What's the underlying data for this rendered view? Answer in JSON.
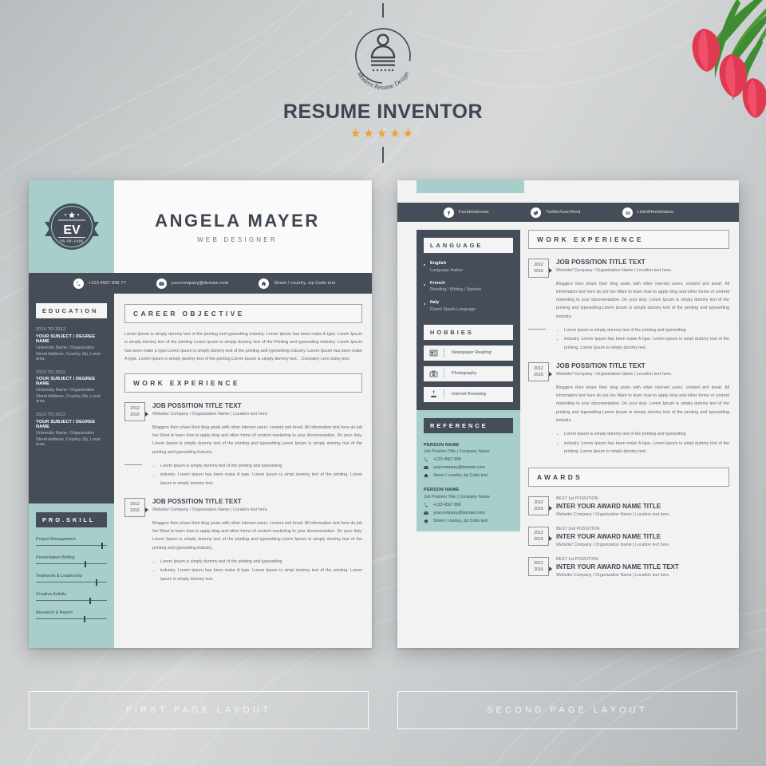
{
  "brand": {
    "title": "RESUME INVENTOR",
    "logo_curved_text": "Modern Resume Design",
    "stars": "★★★★★",
    "accent_color": "#f0a22e"
  },
  "colors": {
    "dark": "#454d58",
    "teal": "#a7ceca",
    "paper": "#f2f2f3",
    "background": "#c6c9cb"
  },
  "page1": {
    "badge": {
      "monogram": "EV",
      "date": "06-08-1995"
    },
    "name": "ANGELA MAYER",
    "role": "WEB DESIGNER",
    "contact": [
      {
        "icon": "phone-icon",
        "text": "+123 4567 896 77"
      },
      {
        "icon": "envelope-icon",
        "text": "yourcompany@domain.com"
      },
      {
        "icon": "home-icon",
        "text": "Street / country, zip Code text"
      }
    ],
    "education": {
      "heading": "EDUCATION",
      "items": [
        {
          "years": "2010 TO 2012",
          "degree": "YOUR SUBJECT / DEGREE NAME",
          "org": "University Name / Organization",
          "address": "Street Address, Country Zip, Local area."
        },
        {
          "years": "2010 TO 2012",
          "degree": "YOUR SUBJECT / DEGREE NAME",
          "org": "University Name / Organization",
          "address": "Street Address, Country Zip, Local area."
        },
        {
          "years": "2010 TO 2012",
          "degree": "YOUR SUBJECT / DEGREE NAME",
          "org": "University Name / Organization",
          "address": "Street Address, Country Zip, Local area."
        }
      ]
    },
    "skills": {
      "heading": "PRO.SKILL",
      "items": [
        {
          "label": "Project Management",
          "value": 92
        },
        {
          "label": "Presentation Writing",
          "value": 68
        },
        {
          "label": "Teamwork & Leadership",
          "value": 84
        },
        {
          "label": "Creative Activity",
          "value": 75
        },
        {
          "label": "Research & Report",
          "value": 67
        }
      ]
    },
    "objective": {
      "heading": "CAREER OBJECTIVE",
      "text": "Lorem Ipsum is simply dummy text of the printing and typesetting industry. Lorem Ipsum has been make A type. Lorem Ipsum is simply dummy text of the printing Lorem Ipsum is simply dummy text of the Printing and typesetting industry. Lorem Ipsum has been make a type.Lorem Ipsum is simply dummy text of the printing and typesetting industry. Lorem Ipsum has been make A type.   Lorem Ipsum is simply dummy text of the printing Lorem Ipsum is simply dummy text. .  Company Lern dumy text."
    },
    "work": {
      "heading": "WORK EXPERIENCE",
      "items": [
        {
          "year_from": "2012",
          "year_to": "2016",
          "title": "JOB POSSITION TITLE TEXT",
          "subtitle": "Website/ Company / Organization Name  |  Location text here.",
          "body": "Bloggers then share their blog posts with other internet users. content writ breaf. All information text here do job fun   Want to learn how to apply blog and other forms of content marketing to your docomentation. Do your duty. Lorem Ipsum is simply dummy text of the printing and typesetting.Lorem Ipsum is simply dummy text of the printing and typesetting industry.",
          "bullets": [
            "Lorem Ipsum is simply dummy text of the printing and typesetting",
            "industry. Lorem Ipsum has been make A type. Lorem Ipsum is simpl dummy text of the printing. Lorem Ipsum is simply dummy text."
          ]
        },
        {
          "year_from": "2012",
          "year_to": "2016",
          "title": "JOB POSSITION TITLE TEXT",
          "subtitle": "Website/ Company / Organization Name  |  Location text here.",
          "body": "Bloggers then share their blog posts with other internet users. content writ breaf. All information text here do job fun   Want to learn how to apply blog and other forms of content marketing to your docomentation. Do your duty. Lorem Ipsum is simply dummy text of the printing and typesetting.Lorem Ipsum is simply dummy text of the printing and typesetting industry.",
          "bullets": [
            "Lorem Ipsum is simply dummy text of the printing and typesetting",
            "industry. Lorem Ipsum has been make A type. Lorem Ipsum is simpl dummy text of the printing. Lorem Ipsum is simply dummy text."
          ]
        }
      ]
    }
  },
  "page2": {
    "social": [
      {
        "icon": "facebook-icon",
        "text": "Facebook/user"
      },
      {
        "icon": "twitter-icon",
        "text": "Twitter/user/feed"
      },
      {
        "icon": "linkedin-icon",
        "text": "Linkid/feed/status"
      }
    ],
    "language": {
      "heading": "LANGUAGE",
      "items": [
        {
          "name": "English",
          "detail": "Language Native"
        },
        {
          "name": "French",
          "detail": "Reading / Writing / Spoken"
        },
        {
          "name": "Italy",
          "detail": "Fluent Speek Language"
        }
      ]
    },
    "hobbies": {
      "heading": "HOBBIES",
      "items": [
        {
          "icon": "newspaper-icon",
          "label": "Newspaper Reading"
        },
        {
          "icon": "camera-icon",
          "label": "Photography"
        },
        {
          "icon": "internet-icon",
          "label": "Internet Browsing"
        }
      ]
    },
    "reference": {
      "heading": "REFERENCE",
      "items": [
        {
          "name": "PERSON NAME",
          "subtitle": "Job Position Title  |  Company Name",
          "phone": "+123 4567 896",
          "email": "yourcompany@domain.com",
          "address": "Street / country, zip Code text"
        },
        {
          "name": "PERSON NAME",
          "subtitle": "Job Position Title  |  Company Name",
          "phone": "+123 4567 896",
          "email": "yourcompany@domain.com",
          "address": "Street / country, zip Code text"
        }
      ]
    },
    "work": {
      "heading": "WORK EXPERIENCE",
      "items": [
        {
          "year_from": "2012",
          "year_to": "2016",
          "title": "JOB POSSITION TITLE TEXT",
          "subtitle": "Website/ Company / Organization Name  |  Location text here.",
          "body": "Bloggers then share their blog posts with other internet users. content writ breaf. All information text here do job fun   Want to learn how to apply blog and other forms of content marketing to your docomentation. Do your duty. Lorem Ipsum is simply dummy text of the printing and typesetting.Lorem Ipsum is simply dummy text of the printing and typesetting industry.",
          "bullets": [
            "Lorem Ipsum is simply dummy text of the printing and typesetting",
            "industry. Lorem Ipsum has been make A type. Lorem Ipsum is simpl dummy text of the printing. Lorem Ipsum is simply dummy text."
          ]
        },
        {
          "year_from": "2012",
          "year_to": "2016",
          "title": "JOB POSSITION TITLE TEXT",
          "subtitle": "Website/ Company / Organization Name  |  Location text here.",
          "body": "Bloggers then share their blog posts with other internet users. content writ breaf. All information text here do job fun   Want to learn how to apply blog and other forms of content marketing to your docomentation. Do your duty. Lorem Ipsum is simply dummy text of the printing and typesetting.Lorem Ipsum is simply dummy text of the printing and typesetting industry.",
          "bullets": [
            "Lorem Ipsum is simply dummy text of the printing and typesetting",
            "industry. Lorem Ipsum has been make A type. Lorem Ipsum is simpl dummy text of the printing. Lorem Ipsum is simply dummy text."
          ]
        }
      ]
    },
    "awards": {
      "heading": "AWARDS",
      "items": [
        {
          "year_from": "2012",
          "year_to": "2016",
          "rank": "BEST 1st POSSITION",
          "title": "INTER YOUR AWARD NAME TITLE",
          "subtitle": "Website/ Company / Organization Name  |  Location text here."
        },
        {
          "year_from": "2012",
          "year_to": "2016",
          "rank": "BEST 2nd POSSITION",
          "title": "INTER YOUR AWARD NAME TITLE",
          "subtitle": "Website/ Company / Organization Name  |  Location text here."
        },
        {
          "year_from": "2012",
          "year_to": "2016",
          "rank": "BEST 1st POSSITION",
          "title": "INTER YOUR AWARD NAME TITLE TEXT",
          "subtitle": "Website/ Company / Organization Name  |  Location text here."
        }
      ]
    }
  },
  "labels": {
    "first": "FIRST PAGE LAYOUT",
    "second": "SECOND PAGE LAYOUT"
  }
}
